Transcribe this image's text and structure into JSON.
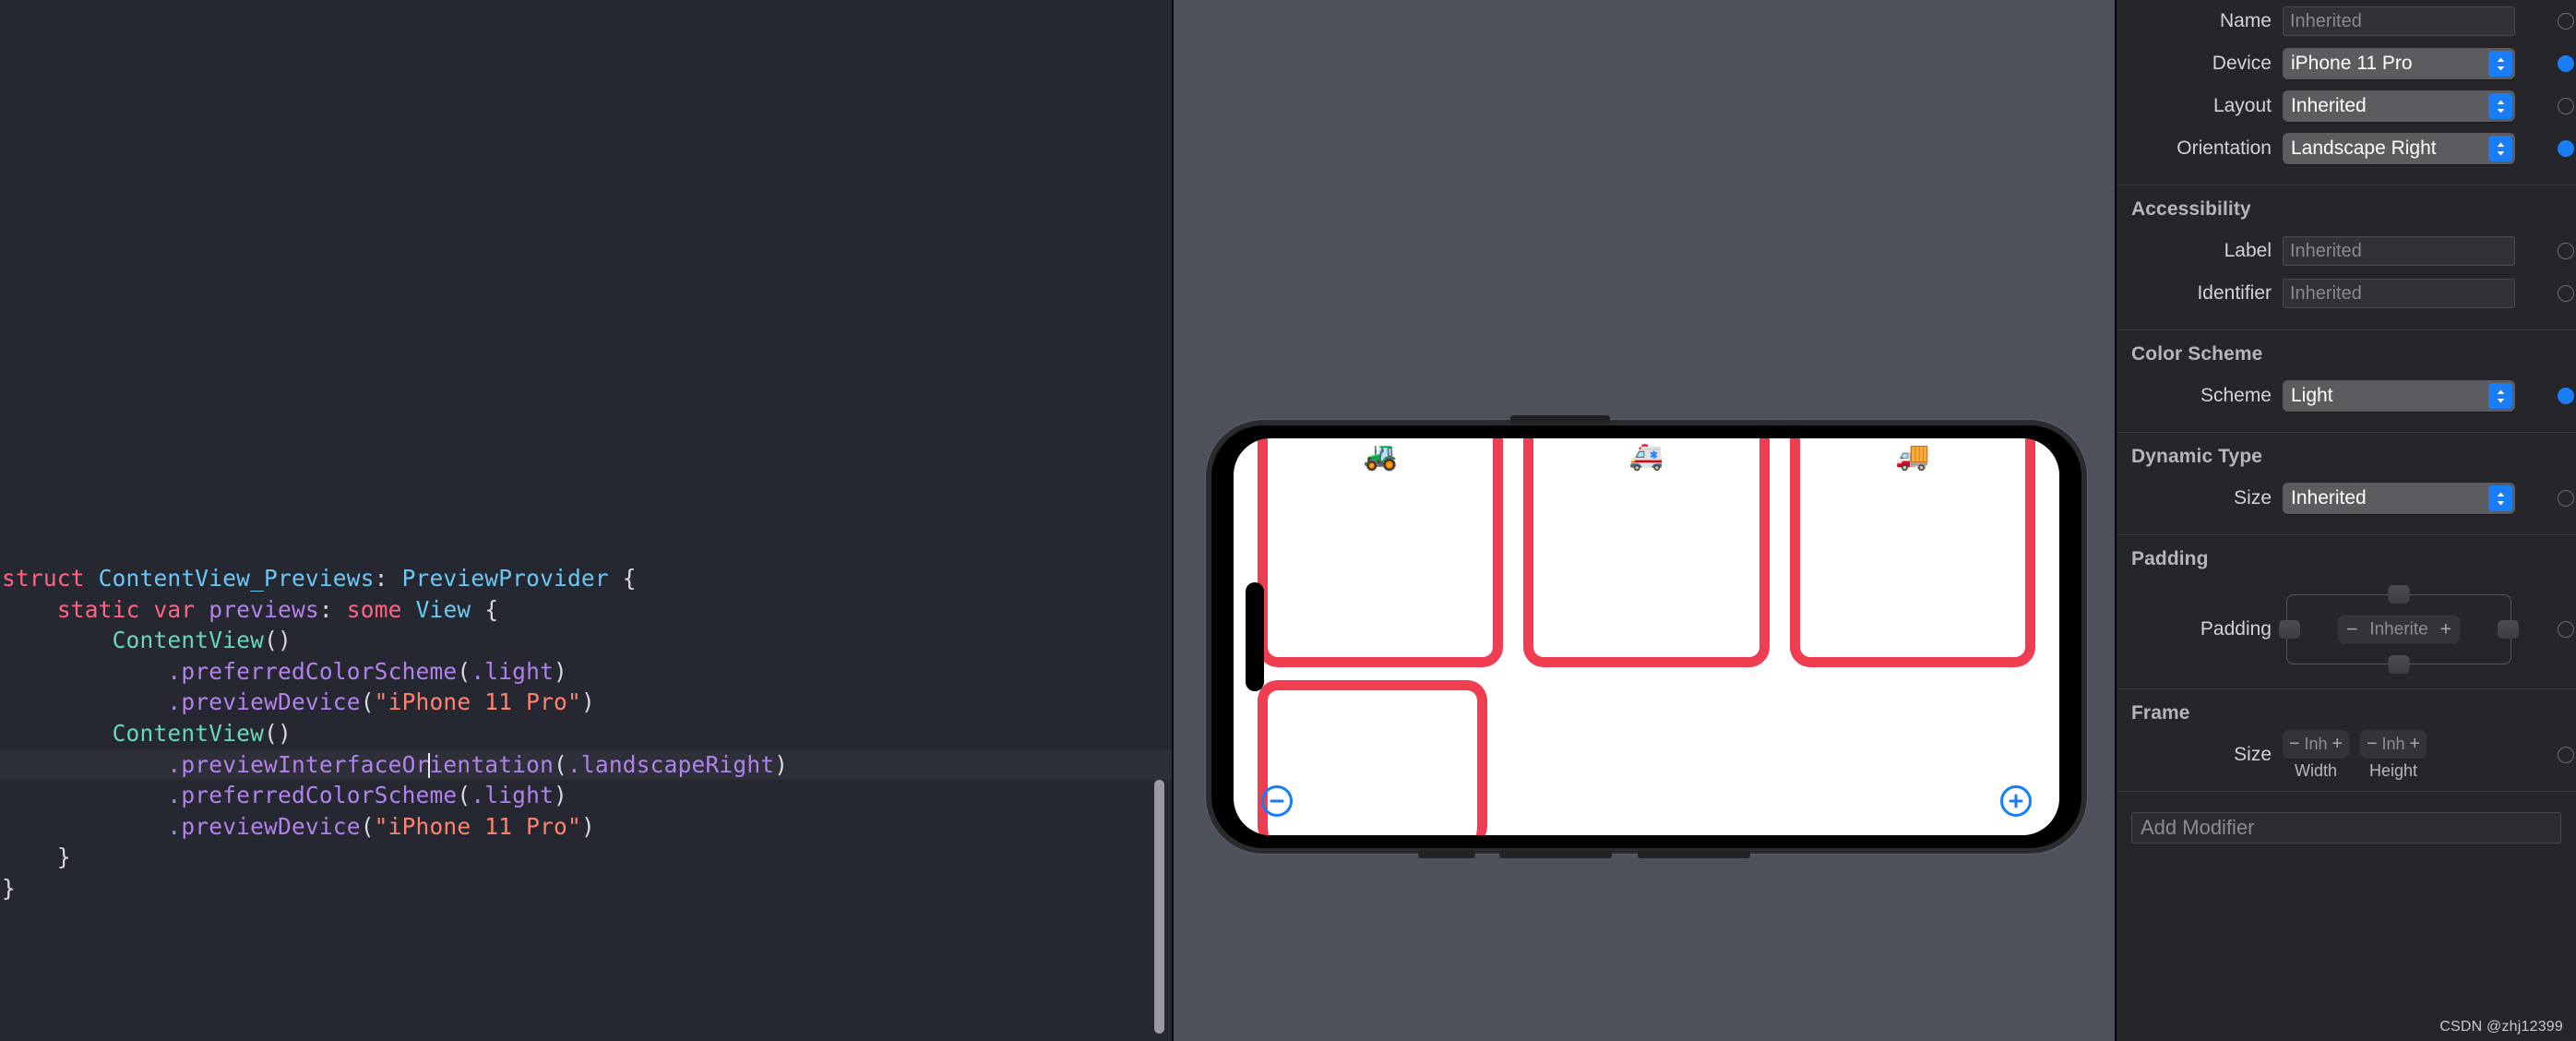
{
  "editor": {
    "language": "swift",
    "cursor_line_index": 7,
    "code_lines": [
      {
        "indent": 0,
        "tokens": [
          {
            "t": "struct ",
            "c": "kw"
          },
          {
            "t": "ContentView_Previews",
            "c": "type"
          },
          {
            "t": ": ",
            "c": "punc"
          },
          {
            "t": "PreviewProvider",
            "c": "type"
          },
          {
            "t": " {",
            "c": "punc"
          }
        ]
      },
      {
        "indent": 1,
        "tokens": [
          {
            "t": "static ",
            "c": "kw"
          },
          {
            "t": "var ",
            "c": "kw"
          },
          {
            "t": "previews",
            "c": "prop"
          },
          {
            "t": ": ",
            "c": "punc"
          },
          {
            "t": "some ",
            "c": "kw"
          },
          {
            "t": "View",
            "c": "type"
          },
          {
            "t": " {",
            "c": "punc"
          }
        ]
      },
      {
        "indent": 2,
        "tokens": [
          {
            "t": "ContentView",
            "c": "fn"
          },
          {
            "t": "()",
            "c": "punc"
          }
        ]
      },
      {
        "indent": 3,
        "tokens": [
          {
            "t": ".",
            "c": "prop"
          },
          {
            "t": "preferredColorScheme",
            "c": "prop"
          },
          {
            "t": "(",
            "c": "punc"
          },
          {
            "t": ".light",
            "c": "prop"
          },
          {
            "t": ")",
            "c": "punc"
          }
        ]
      },
      {
        "indent": 3,
        "tokens": [
          {
            "t": ".",
            "c": "prop"
          },
          {
            "t": "previewDevice",
            "c": "prop"
          },
          {
            "t": "(",
            "c": "punc"
          },
          {
            "t": "\"iPhone 11 Pro\"",
            "c": "str"
          },
          {
            "t": ")",
            "c": "punc"
          }
        ]
      },
      {
        "indent": 2,
        "tokens": [
          {
            "t": "ContentView",
            "c": "fn"
          },
          {
            "t": "()",
            "c": "punc"
          }
        ]
      },
      {
        "indent": 3,
        "active": true,
        "tokens": [
          {
            "t": ".",
            "c": "prop"
          },
          {
            "t": "previewInterfaceOr",
            "c": "prop"
          },
          {
            "caret": true
          },
          {
            "t": "ientation",
            "c": "prop"
          },
          {
            "t": "(",
            "c": "punc"
          },
          {
            "t": ".landscapeRight",
            "c": "prop"
          },
          {
            "t": ")",
            "c": "punc"
          }
        ]
      },
      {
        "indent": 3,
        "tokens": [
          {
            "t": ".",
            "c": "prop"
          },
          {
            "t": "preferredColorScheme",
            "c": "prop"
          },
          {
            "t": "(",
            "c": "punc"
          },
          {
            "t": ".light",
            "c": "prop"
          },
          {
            "t": ")",
            "c": "punc"
          }
        ]
      },
      {
        "indent": 3,
        "tokens": [
          {
            "t": ".",
            "c": "prop"
          },
          {
            "t": "previewDevice",
            "c": "prop"
          },
          {
            "t": "(",
            "c": "punc"
          },
          {
            "t": "\"iPhone 11 Pro\"",
            "c": "str"
          },
          {
            "t": ")",
            "c": "punc"
          }
        ]
      },
      {
        "indent": 1,
        "tokens": [
          {
            "t": "}",
            "c": "punc"
          }
        ]
      },
      {
        "indent": 0,
        "tokens": [
          {
            "t": "}",
            "c": "punc"
          }
        ]
      }
    ]
  },
  "canvas": {
    "background_color": "#4d515b",
    "device_name": "iPhone 11 Pro",
    "orientation": "Landscape Right",
    "color_scheme": "Light",
    "preview": {
      "card_border_color": "#ef3e52",
      "screen_background": "#ffffff",
      "top_cards": [
        {
          "vehicle_icon": "tractor",
          "glyph": "🚜"
        },
        {
          "vehicle_icon": "ambulance",
          "glyph": "🚑"
        },
        {
          "vehicle_icon": "truck",
          "glyph": "🚚"
        }
      ],
      "bottom_card": {
        "vehicle_icon": "none",
        "glyph": ""
      },
      "minus_button_label": "−",
      "plus_button_label": "+",
      "stepper_color": "#157efb"
    }
  },
  "inspector": {
    "sections": [
      {
        "id": "preview",
        "title": "",
        "rows": [
          {
            "label": "Name",
            "control": "textfield",
            "value": "",
            "placeholder": "Inherited",
            "toggle": "off"
          },
          {
            "label": "Device",
            "control": "popup",
            "value": "iPhone 11 Pro",
            "toggle": "on"
          },
          {
            "label": "Layout",
            "control": "popup",
            "value": "Inherited",
            "toggle": "off"
          },
          {
            "label": "Orientation",
            "control": "popup",
            "value": "Landscape Right",
            "toggle": "on"
          }
        ]
      },
      {
        "id": "accessibility",
        "title": "Accessibility",
        "rows": [
          {
            "label": "Label",
            "control": "textfield",
            "value": "",
            "placeholder": "Inherited",
            "toggle": "off"
          },
          {
            "label": "Identifier",
            "control": "textfield",
            "value": "",
            "placeholder": "Inherited",
            "toggle": "off"
          }
        ]
      },
      {
        "id": "color-scheme",
        "title": "Color Scheme",
        "rows": [
          {
            "label": "Scheme",
            "control": "popup",
            "value": "Light",
            "toggle": "on"
          }
        ]
      },
      {
        "id": "dynamic-type",
        "title": "Dynamic Type",
        "rows": [
          {
            "label": "Size",
            "control": "popup",
            "value": "Inherited",
            "toggle": "off"
          }
        ]
      },
      {
        "id": "padding",
        "title": "Padding",
        "rows": [
          {
            "label": "Padding",
            "control": "padding",
            "value": "Inherite",
            "minus": "−",
            "plus": "+",
            "toggle": "off"
          }
        ]
      },
      {
        "id": "frame",
        "title": "Frame",
        "rows": [
          {
            "label": "Size",
            "control": "frame",
            "width_value": "Inh",
            "width_caption": "Width",
            "height_value": "Inh",
            "height_caption": "Height",
            "minus": "−",
            "plus": "+",
            "toggle": "off"
          }
        ]
      }
    ],
    "add_modifier_placeholder": "Add Modifier",
    "accent_color": "#1a7df5"
  },
  "watermark": "CSDN @zhj12399"
}
